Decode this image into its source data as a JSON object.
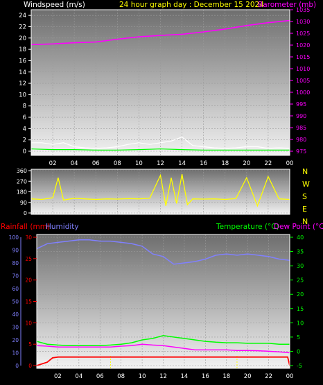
{
  "header": {
    "wind_label": "Windspeed (m/s)",
    "title": "24 hour graph day : December 15 2024",
    "baro_label": "Barometer (mb)"
  },
  "compass": [
    "N",
    "W",
    "S",
    "E",
    "N"
  ],
  "bottom_header": {
    "rain_label": "Rainfall (mm)",
    "humidity_label": "Humidity",
    "temp_label": "Temperature (°C)",
    "dew_label": "Dew Point (°C)"
  },
  "colors": {
    "wind_label": "#ffffff",
    "title": "#ffff00",
    "baro": "#ff00ff",
    "wind": "#ffffff",
    "wind_avg": "#00ff00",
    "direction": "#ffff00",
    "rain": "#ff0000",
    "humidity": "#8080ff",
    "temperature": "#00ff00",
    "dewpoint": "#ff00ff",
    "compass": "#ffff00"
  },
  "chart_data": [
    {
      "type": "line",
      "hour_labels": [
        "02",
        "04",
        "06",
        "08",
        "10",
        "12",
        "14",
        "16",
        "18",
        "20",
        "22",
        "00"
      ],
      "wind_ticks": [
        "0",
        "2",
        "4",
        "6",
        "8",
        "10",
        "12",
        "14",
        "16",
        "18",
        "20",
        "22",
        "24"
      ],
      "baro_ticks": [
        "975",
        "980",
        "985",
        "990",
        "995",
        "1000",
        "1005",
        "1010",
        "1015",
        "1020",
        "1025",
        "1030",
        "1035"
      ],
      "ylim_wind": [
        0,
        25
      ],
      "ylim_baro": [
        975,
        1035
      ],
      "x_hours": [
        0,
        24
      ],
      "series": [
        {
          "key": "barometer",
          "axis": "right",
          "x": [
            0,
            2,
            4,
            6,
            8,
            10,
            12,
            14,
            16,
            18,
            20,
            22,
            24
          ],
          "values": [
            1020.2,
            1020.5,
            1021.0,
            1021.3,
            1022.5,
            1023.5,
            1024.1,
            1024.6,
            1025.6,
            1026.8,
            1028.3,
            1029.5,
            1030.4
          ]
        },
        {
          "key": "wind_gust",
          "axis": "left",
          "x": [
            0,
            1,
            2,
            3,
            4,
            5,
            6,
            7,
            8,
            9,
            10,
            11,
            12,
            13,
            14,
            15,
            16,
            17,
            18,
            19,
            20,
            21,
            22,
            23,
            24
          ],
          "values": [
            1.5,
            1.5,
            1.2,
            1.5,
            0.8,
            0.6,
            0.5,
            0.6,
            0.8,
            1.2,
            1.5,
            1.2,
            1.5,
            1.8,
            2.5,
            1.0,
            0.8,
            0.6,
            0.5,
            0.6,
            0.8,
            0.8,
            0.5,
            0.6,
            0.5
          ]
        },
        {
          "key": "wind_average",
          "axis": "left",
          "x": [
            0,
            2,
            4,
            6,
            8,
            10,
            12,
            14,
            16,
            18,
            20,
            22,
            24
          ],
          "values": [
            0.4,
            0.3,
            0.3,
            0.2,
            0.2,
            0.3,
            0.4,
            0.3,
            0.2,
            0.2,
            0.2,
            0.2,
            0.2
          ]
        }
      ]
    },
    {
      "type": "scatter",
      "hour_labels": [
        "02",
        "04",
        "06",
        "08",
        "10",
        "12",
        "14",
        "16",
        "18",
        "20",
        "22",
        "00"
      ],
      "dir_ticks": [
        "0",
        "90",
        "180",
        "270",
        "360"
      ],
      "ylim": [
        0,
        360
      ],
      "series": [
        {
          "key": "wind_direction",
          "x": [
            0,
            1,
            2,
            2.5,
            3,
            4,
            5,
            6,
            7,
            8,
            9,
            10,
            11,
            12,
            12.5,
            13,
            13.5,
            14,
            14.5,
            15,
            16,
            17,
            18,
            19,
            20,
            21,
            22,
            23,
            24
          ],
          "values": [
            120,
            115,
            130,
            300,
            110,
            125,
            120,
            115,
            120,
            118,
            122,
            120,
            125,
            320,
            60,
            300,
            80,
            330,
            70,
            120,
            118,
            120,
            115,
            122,
            300,
            60,
            310,
            120,
            115
          ]
        }
      ]
    },
    {
      "type": "line",
      "hour_labels": [
        "02",
        "04",
        "06",
        "08",
        "10",
        "12",
        "14",
        "16",
        "18",
        "20",
        "22",
        "00"
      ],
      "humidity_ticks": [
        "0",
        "10",
        "20",
        "30",
        "40",
        "50",
        "60",
        "70",
        "80",
        "90",
        "100"
      ],
      "rain_ticks": [
        "0",
        "5",
        "10",
        "15",
        "20",
        "25",
        "30"
      ],
      "temp_ticks": [
        "-5",
        "0",
        "5",
        "10",
        "15",
        "20",
        "25",
        "30",
        "35",
        "40"
      ],
      "ylim_humidity": [
        0,
        100
      ],
      "ylim_rain": [
        0,
        30
      ],
      "ylim_temp": [
        -5,
        40
      ],
      "series": [
        {
          "key": "humidity",
          "axis": "humidity",
          "x": [
            0,
            1,
            2,
            3,
            4,
            5,
            6,
            7,
            8,
            9,
            10,
            11,
            12,
            13,
            14,
            15,
            16,
            17,
            18,
            19,
            20,
            21,
            22,
            23,
            24
          ],
          "values": [
            91,
            95,
            96,
            97,
            98,
            98,
            97,
            97,
            96,
            95,
            93,
            87,
            85,
            79,
            80,
            81,
            83,
            86,
            87,
            86,
            87,
            86,
            85,
            83,
            82
          ]
        },
        {
          "key": "temperature",
          "axis": "temp",
          "x": [
            0,
            1,
            2,
            3,
            4,
            5,
            6,
            7,
            8,
            9,
            10,
            11,
            12,
            13,
            14,
            15,
            16,
            17,
            18,
            19,
            20,
            21,
            22,
            23,
            24
          ],
          "values": [
            3.5,
            2.5,
            2.2,
            2.0,
            2.0,
            2.0,
            2.0,
            2.2,
            2.5,
            3.0,
            4.0,
            4.5,
            5.5,
            5.0,
            4.5,
            4.0,
            3.5,
            3.2,
            3.0,
            3.0,
            2.8,
            2.8,
            2.8,
            2.5,
            2.5
          ]
        },
        {
          "key": "dewpoint",
          "axis": "temp",
          "x": [
            0,
            1,
            2,
            3,
            4,
            5,
            6,
            7,
            8,
            9,
            10,
            11,
            12,
            13,
            14,
            15,
            16,
            17,
            18,
            19,
            20,
            21,
            22,
            23,
            24
          ],
          "values": [
            2.0,
            1.8,
            1.5,
            1.5,
            1.5,
            1.5,
            1.5,
            1.5,
            1.8,
            2.0,
            2.5,
            2.2,
            2.0,
            1.5,
            1.0,
            0.5,
            0.5,
            0.5,
            0.5,
            0.3,
            0.3,
            0.2,
            0.0,
            -0.2,
            -0.5
          ]
        },
        {
          "key": "rainfall",
          "axis": "rain",
          "x": [
            0,
            1,
            1.5,
            2,
            4,
            6,
            8,
            10,
            12,
            14,
            16,
            18,
            20,
            22,
            23.8,
            24
          ],
          "values": [
            0,
            0.8,
            1.8,
            2.0,
            2.0,
            2.0,
            2.0,
            2.0,
            2.0,
            2.0,
            2.0,
            2.0,
            2.0,
            2.0,
            2.0,
            0
          ]
        }
      ],
      "markers_hours": [
        7,
        19
      ]
    }
  ]
}
